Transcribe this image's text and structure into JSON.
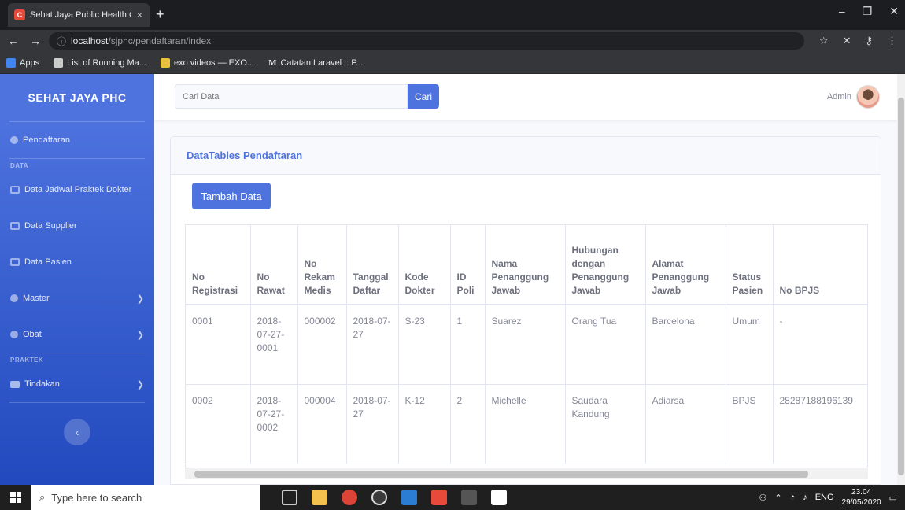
{
  "browser": {
    "tab_title": "Sehat Jaya Public Health Center",
    "url_host": "localhost",
    "url_path": "/sjphc/pendaftaran/index",
    "bookmarks": [
      "Apps",
      "List of Running Ma...",
      "exo videos — EXO...",
      "Catatan Laravel :: P..."
    ]
  },
  "sidebar": {
    "brand": "SEHAT JAYA PHC",
    "items": [
      {
        "label": "Pendaftaran"
      },
      {
        "heading": "DATA"
      },
      {
        "label": "Data Jadwal Praktek Dokter"
      },
      {
        "label": "Data Supplier"
      },
      {
        "label": "Data Pasien"
      },
      {
        "label": "Master"
      },
      {
        "label": "Obat"
      },
      {
        "heading": "PRAKTEK"
      },
      {
        "label": "Tindakan"
      }
    ]
  },
  "topbar": {
    "search_placeholder": "Cari Data",
    "search_button": "Cari",
    "user_name": "Admin"
  },
  "card": {
    "title": "DataTables Pendaftaran",
    "add_button": "Tambah Data"
  },
  "table": {
    "headers": [
      "No Registrasi",
      "No Rawat",
      "No Rekam Medis",
      "Tanggal Daftar",
      "Kode Dokter",
      "ID Poli",
      "Nama Penanggung Jawab",
      "Hubungan dengan Penanggung Jawab",
      "Alamat Penanggung Jawab",
      "Status Pasien",
      "No BPJS"
    ],
    "rows": [
      [
        "0001",
        "2018-07-27-0001",
        "000002",
        "2018-07-27",
        "S-23",
        "1",
        "Suarez",
        "Orang Tua",
        "Barcelona",
        "Umum",
        "-"
      ],
      [
        "0002",
        "2018-07-27-0002",
        "000004",
        "2018-07-27",
        "K-12",
        "2",
        "Michelle",
        "Saudara Kandung",
        "Adiarsa",
        "BPJS",
        "28287188196139"
      ]
    ]
  },
  "taskbar": {
    "search_placeholder": "Type here to search",
    "lang": "ENG",
    "time": "23.04",
    "date": "29/05/2020"
  },
  "colors": {
    "primary": "#4e73df",
    "sidebar_bottom": "#224abe",
    "text_muted": "#858796"
  }
}
